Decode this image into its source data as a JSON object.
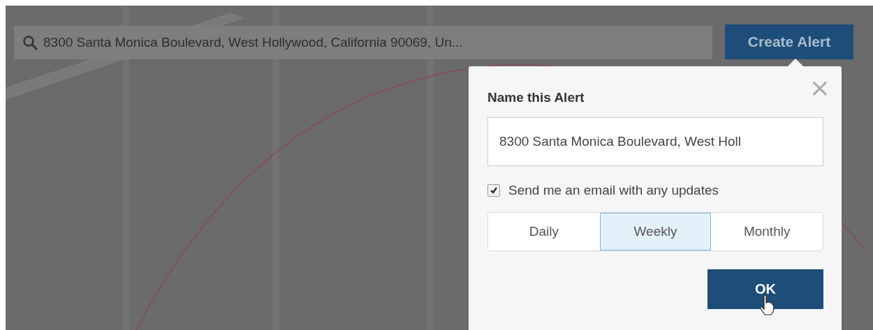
{
  "search": {
    "value": "8300 Santa Monica Boulevard, West Hollywood, California 90069, Un..."
  },
  "create_button": {
    "label": "Create Alert"
  },
  "dialog": {
    "title": "Name this Alert",
    "close": "×",
    "name_field": {
      "value": "8300 Santa Monica Boulevard, West Holl"
    },
    "email_option": {
      "label": "Send me an email with any updates",
      "checked": true
    },
    "frequency": [
      {
        "label": "Daily",
        "selected": false
      },
      {
        "label": "Weekly",
        "selected": true
      },
      {
        "label": "Monthly",
        "selected": false
      }
    ],
    "ok_button": {
      "label": "OK"
    }
  }
}
